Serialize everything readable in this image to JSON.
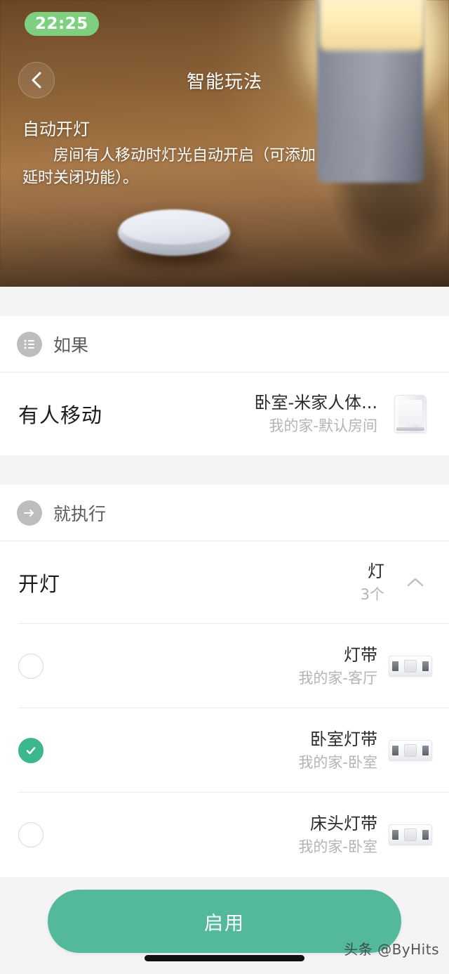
{
  "status_bar": {
    "time": "22:25"
  },
  "nav": {
    "back_icon": "chevron-left-icon",
    "title": "智能玩法"
  },
  "hero": {
    "title": "自动开灯",
    "description": "房间有人移动时灯光自动开启（可添加延时关闭功能）。"
  },
  "if_section": {
    "icon": "list-icon",
    "label": "如果",
    "trigger": {
      "title": "有人移动",
      "device_name": "卧室-米家人体...",
      "device_location": "我的家-默认房间",
      "thumbnail": "motion-sensor-icon"
    }
  },
  "then_section": {
    "icon": "arrow-right-icon",
    "label": "就执行",
    "action": {
      "title": "开灯",
      "group_name": "灯",
      "count_label": "3个",
      "collapse_icon": "chevron-up-icon"
    },
    "devices": [
      {
        "name": "灯带",
        "location": "我的家-客厅",
        "selected": false,
        "thumbnail": "led-strip-icon"
      },
      {
        "name": "卧室灯带",
        "location": "我的家-卧室",
        "selected": true,
        "thumbnail": "led-strip-icon"
      },
      {
        "name": "床头灯带",
        "location": "我的家-卧室",
        "selected": false,
        "thumbnail": "led-strip-icon"
      }
    ]
  },
  "footer": {
    "enable_label": "启用",
    "watermark": "头条 @ByHits"
  },
  "colors": {
    "accent_green": "#54b99c",
    "check_green": "#3bb68d",
    "status_pill_green": "#7ed07e",
    "page_bg": "#f4f4f4"
  }
}
